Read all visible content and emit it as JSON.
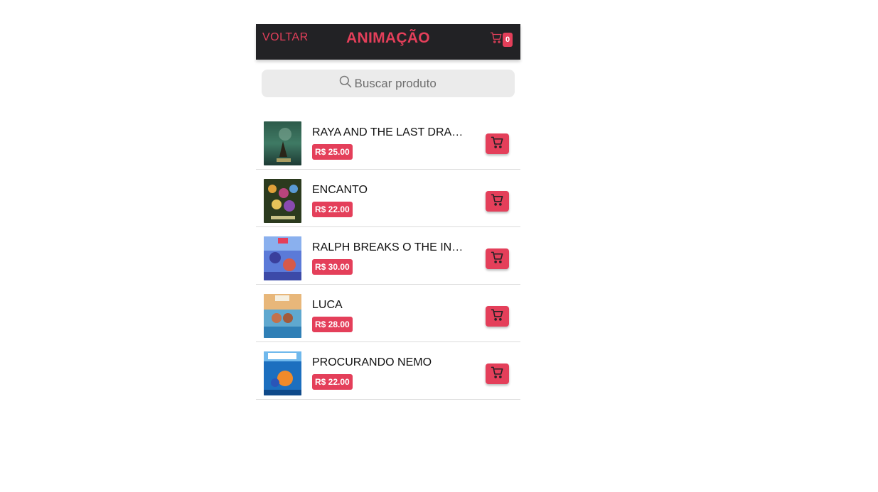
{
  "header": {
    "back_label": "VOLTAR",
    "title": "ANIMAÇÃO",
    "cart_count": "0",
    "cart_icon": "shopping-cart-icon"
  },
  "search": {
    "placeholder": "Buscar produto",
    "value": "",
    "icon": "search-icon"
  },
  "products": [
    {
      "name": "RAYA AND THE LAST DRAGON",
      "price": "R$ 25.00"
    },
    {
      "name": "ENCANTO",
      "price": "R$ 22.00"
    },
    {
      "name": "RALPH BREAKS O THE INTERNET",
      "price": "R$ 30.00"
    },
    {
      "name": "LUCA",
      "price": "R$ 28.00"
    },
    {
      "name": "PROCURANDO NEMO",
      "price": "R$ 22.00"
    }
  ],
  "colors": {
    "accent": "#e43f5a",
    "header_bg": "#222225",
    "search_bg": "#ebebeb"
  }
}
